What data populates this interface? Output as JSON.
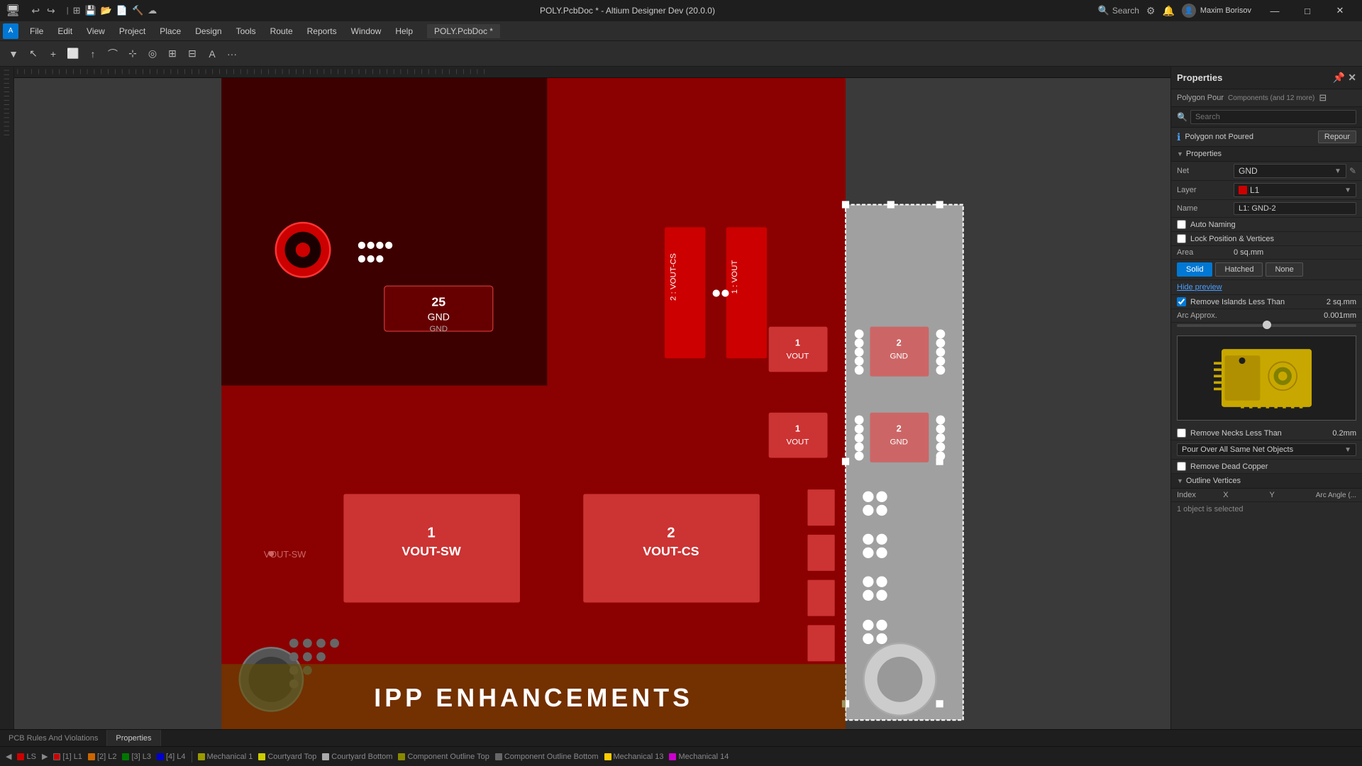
{
  "titlebar": {
    "title": "POLY.PcbDoc * - Altium Designer Dev (20.0.0)",
    "search_placeholder": "Search",
    "user": "Maxim Borisov",
    "minimize": "—",
    "maximize": "□",
    "close": "✕"
  },
  "menubar": {
    "app_tab": "POLY.PcbDoc *",
    "items": [
      "File",
      "Edit",
      "View",
      "Project",
      "Place",
      "Design",
      "Tools",
      "Route",
      "Reports",
      "Window",
      "Help"
    ]
  },
  "properties_panel": {
    "title": "Properties",
    "subtitle": "Polygon Pour",
    "subtitle2": "Components (and 12 more)",
    "search_placeholder": "Search",
    "warning": "Polygon not Poured",
    "repour_label": "Repour",
    "sections": {
      "properties_label": "Properties",
      "net_label": "Net",
      "net_value": "GND",
      "layer_label": "Layer",
      "layer_value": "L1",
      "name_label": "Name",
      "name_value": "L1: GND-2",
      "auto_naming_label": "Auto Naming",
      "lock_label": "Lock Position & Vertices",
      "area_label": "Area",
      "area_value": "0 sq.mm",
      "fill_solid": "Solid",
      "fill_hatched": "Hatched",
      "fill_none": "None",
      "hide_preview": "Hide preview",
      "remove_islands_label": "Remove Islands Less Than",
      "remove_islands_value": "2 sq.mm",
      "arc_approx_label": "Arc Approx.",
      "arc_approx_value": "0.001mm",
      "remove_necks_label": "Remove Necks Less Than",
      "remove_necks_value": "0.2mm",
      "pour_over_label": "Pour Over All Same Net Objects",
      "remove_dead_copper_label": "Remove Dead Copper"
    },
    "outline_vertices": {
      "title": "Outline Vertices",
      "col_index": "Index",
      "col_x": "X",
      "col_y": "Y",
      "col_arc": "Arc Angle (...",
      "count_label": "1 object is selected"
    }
  },
  "bottom_tabs": {
    "tab1": "PCB Rules And Violations",
    "tab2": "Properties"
  },
  "statusbar": {
    "layers": [
      {
        "label": "LS",
        "color": "#cc0000"
      },
      {
        "label": "[1] L1",
        "color": "#cc0000"
      },
      {
        "label": "[2] L2",
        "color": "#cc6600"
      },
      {
        "label": "[3] L3",
        "color": "#009900"
      },
      {
        "label": "[4] L4",
        "color": "#0000cc"
      },
      {
        "label": "Mechanical 1",
        "color": "#999900"
      },
      {
        "label": "Courtyard Top",
        "color": "#cccc00"
      },
      {
        "label": "Courtyard Bottom",
        "color": "#aaaaaa"
      },
      {
        "label": "Component Outline Top",
        "color": "#888800"
      },
      {
        "label": "Component Outline Bottom",
        "color": "#888888"
      },
      {
        "label": "Mechanical 13",
        "color": "#ffcc00"
      },
      {
        "label": "Mechanical 14",
        "color": "#cc00cc"
      }
    ],
    "selection_info": "1 object is selected"
  },
  "canvas": {
    "title_overlay": "IPP ENHANCEMENTS"
  }
}
